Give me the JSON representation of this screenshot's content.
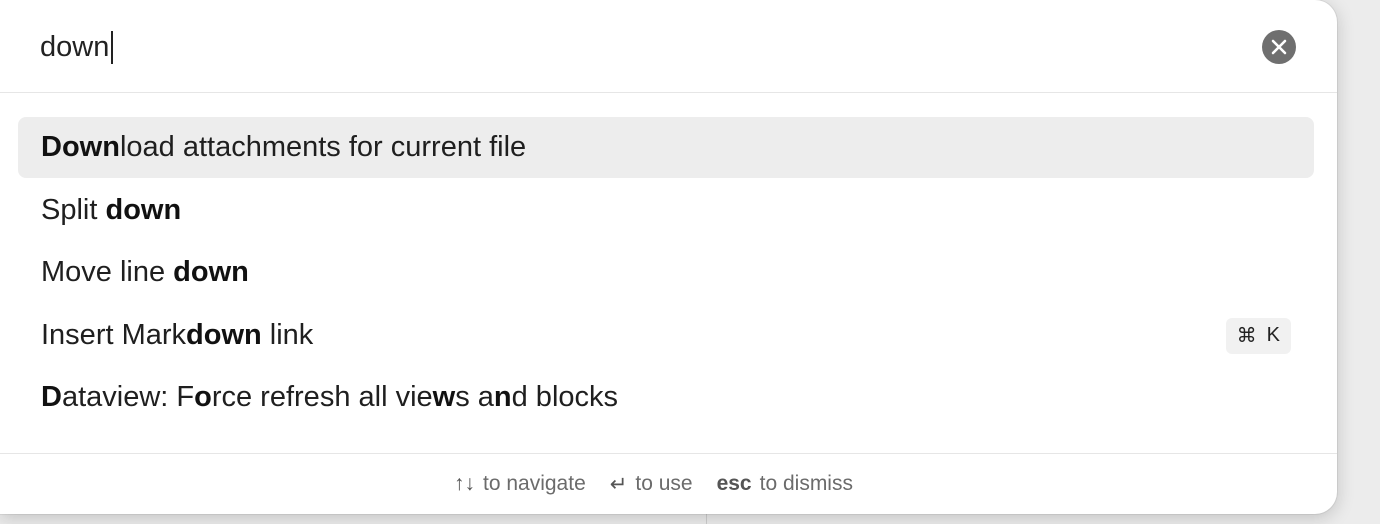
{
  "search": {
    "value": "down",
    "placeholder": ""
  },
  "results": [
    {
      "parts": [
        {
          "t": "Down",
          "b": true
        },
        {
          "t": "load attachments for current file",
          "b": false
        }
      ],
      "selected": true,
      "hotkey": null
    },
    {
      "parts": [
        {
          "t": "Split ",
          "b": false
        },
        {
          "t": "down",
          "b": true
        }
      ],
      "selected": false,
      "hotkey": null
    },
    {
      "parts": [
        {
          "t": "Move line ",
          "b": false
        },
        {
          "t": "down",
          "b": true
        }
      ],
      "selected": false,
      "hotkey": null
    },
    {
      "parts": [
        {
          "t": "Insert Mark",
          "b": false
        },
        {
          "t": "down",
          "b": true
        },
        {
          "t": " link",
          "b": false
        }
      ],
      "selected": false,
      "hotkey": {
        "modifier": "⌘",
        "key": "K"
      }
    },
    {
      "parts": [
        {
          "t": "D",
          "b": true
        },
        {
          "t": "ataview: F",
          "b": false
        },
        {
          "t": "o",
          "b": true
        },
        {
          "t": "rce refresh all vie",
          "b": false
        },
        {
          "t": "w",
          "b": true
        },
        {
          "t": "s a",
          "b": false
        },
        {
          "t": "n",
          "b": true
        },
        {
          "t": "d blocks",
          "b": false
        }
      ],
      "selected": false,
      "hotkey": null
    }
  ],
  "footer": {
    "navigate_key": "↑↓",
    "navigate_label": "to navigate",
    "use_key": "↵",
    "use_label": "to use",
    "dismiss_key": "esc",
    "dismiss_label": "to dismiss"
  },
  "icons": {
    "clear": "close-circle-icon"
  },
  "colors": {
    "selected_row": "#ededed",
    "clear_button": "#6f6f6f",
    "hint_text": "#6b6b6b"
  }
}
